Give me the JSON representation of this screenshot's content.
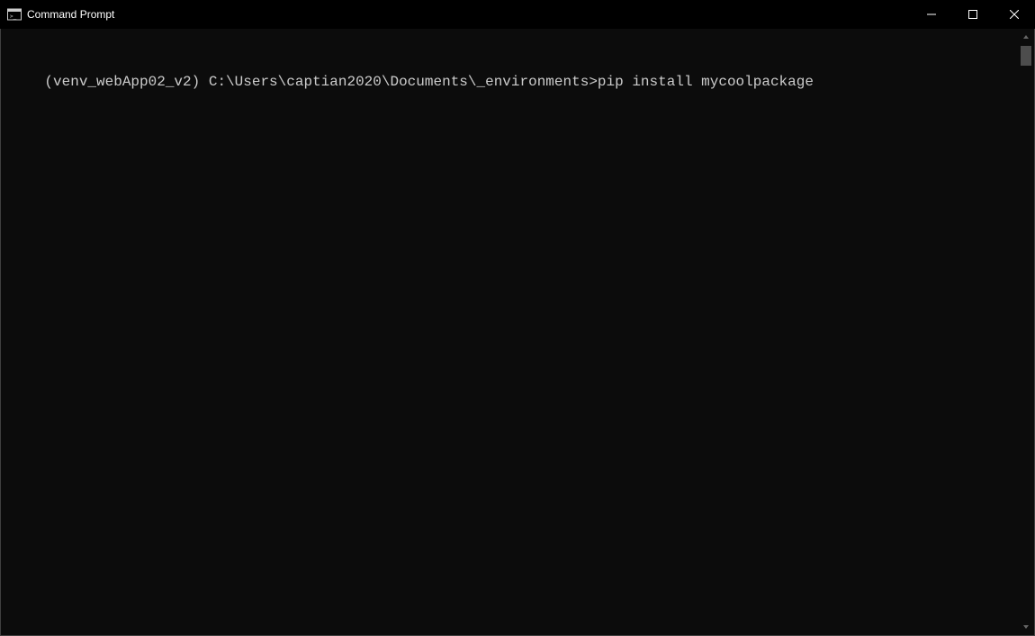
{
  "window": {
    "title": "Command Prompt"
  },
  "terminal": {
    "prompt_env": "(venv_webApp02_v2) ",
    "prompt_path": "C:\\Users\\captian2020\\Documents\\_environments>",
    "command": "pip install mycoolpackage"
  }
}
